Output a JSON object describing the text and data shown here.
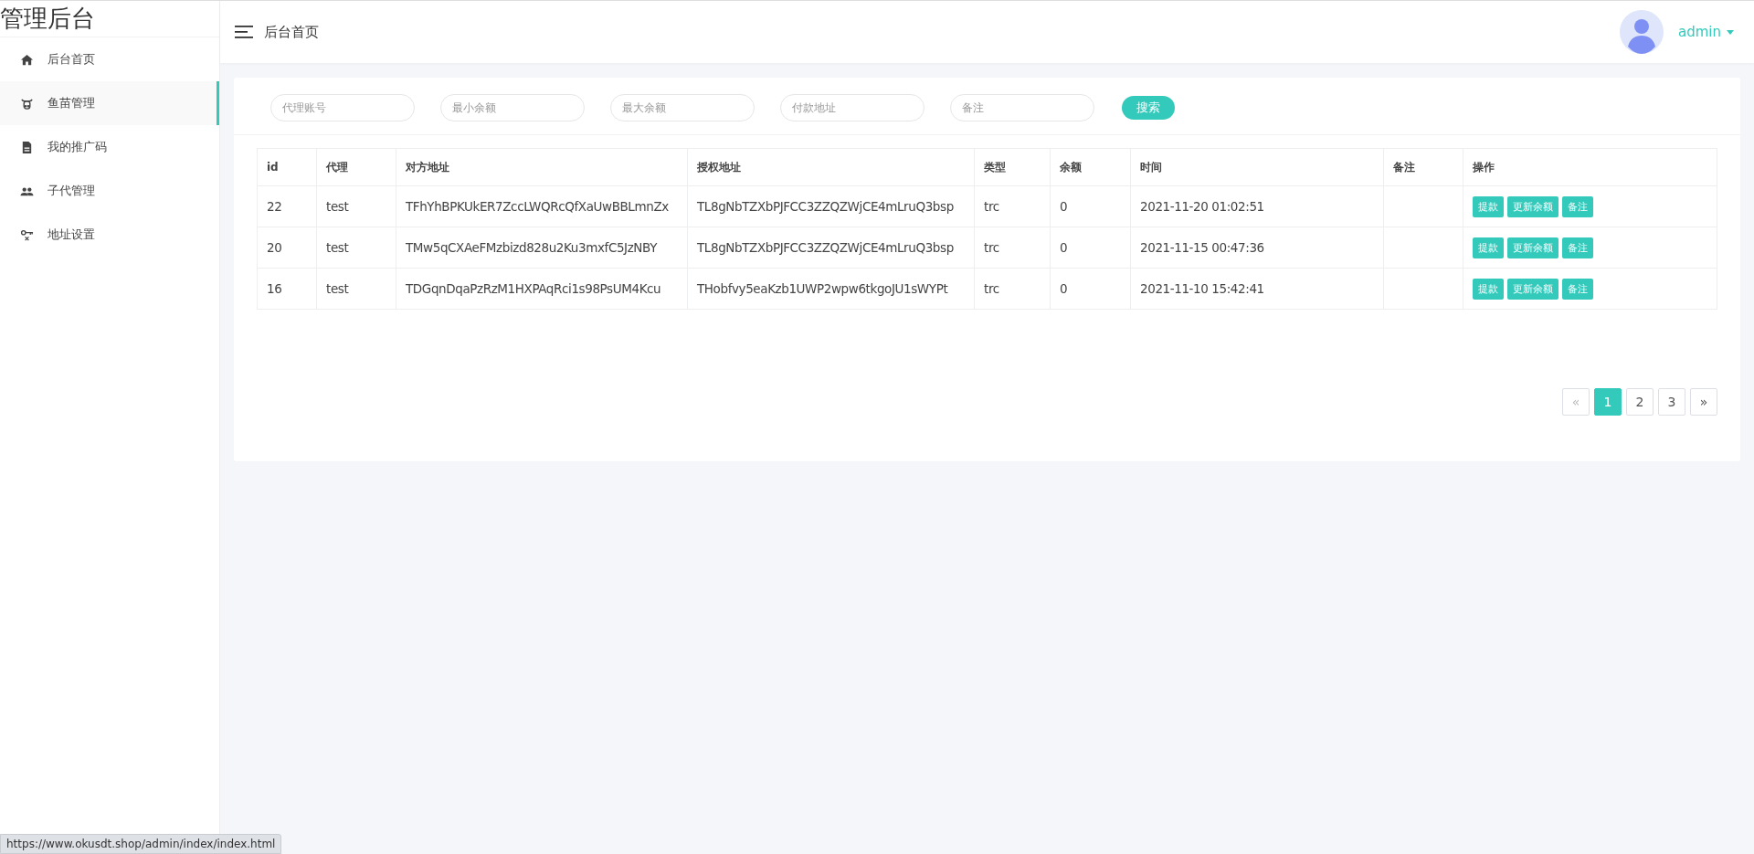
{
  "sidebar": {
    "title": "管理后台",
    "items": [
      {
        "label": "后台首页",
        "selected": false
      },
      {
        "label": "鱼苗管理",
        "selected": true
      },
      {
        "label": "我的推广码",
        "selected": false
      },
      {
        "label": "子代管理",
        "selected": false
      },
      {
        "label": "地址设置",
        "selected": false
      }
    ]
  },
  "header": {
    "title": "后台首页",
    "user": "admin"
  },
  "filters": {
    "fields": [
      {
        "placeholder": "代理账号"
      },
      {
        "placeholder": "最小余额"
      },
      {
        "placeholder": "最大余额"
      },
      {
        "placeholder": "付款地址"
      },
      {
        "placeholder": "备注"
      }
    ],
    "search_button": "搜索"
  },
  "table": {
    "columns": [
      "id",
      "代理",
      "对方地址",
      "授权地址",
      "类型",
      "余额",
      "时间",
      "备注",
      "操作"
    ],
    "rows": [
      {
        "id": "22",
        "agent": "test",
        "counterparty_address": "TFhYhBPKUkER7ZccLWQRcQfXaUwBBLmnZx",
        "auth_address": "TL8gNbTZXbPJFCC3ZZQZWjCE4mLruQ3bsp",
        "type": "trc",
        "balance": "0",
        "time": "2021-11-20 01:02:51",
        "actions": [
          "提款",
          "更新余额",
          "备注"
        ]
      },
      {
        "id": "20",
        "agent": "test",
        "counterparty_address": "TMw5qCXAeFMzbizd828u2Ku3mxfC5JzNBY",
        "auth_address": "TL8gNbTZXbPJFCC3ZZQZWjCE4mLruQ3bsp",
        "type": "trc",
        "balance": "0",
        "time": "2021-11-15 00:47:36",
        "actions": [
          "提款",
          "更新余额",
          "备注"
        ]
      },
      {
        "id": "16",
        "agent": "test",
        "counterparty_address": "TDGqnDqaPzRzM1HXPAqRci1s98PsUM4Kcu",
        "auth_address": "THobfvy5eaKzb1UWP2wpw6tkgoJU1sWYPt",
        "type": "trc",
        "balance": "0",
        "time": "2021-11-10 15:42:41",
        "actions": [
          "提款",
          "更新余额",
          "备注"
        ]
      }
    ]
  },
  "pagination": {
    "prev": {
      "label": "«",
      "disabled": true
    },
    "pages": [
      {
        "label": "1",
        "selected": true
      },
      {
        "label": "2",
        "selected": false
      },
      {
        "label": "3",
        "selected": false
      }
    ],
    "next": {
      "label": "»",
      "disabled": false
    }
  },
  "status_bar": {
    "url": "https://www.okusdt.shop/admin/index/index.html"
  }
}
